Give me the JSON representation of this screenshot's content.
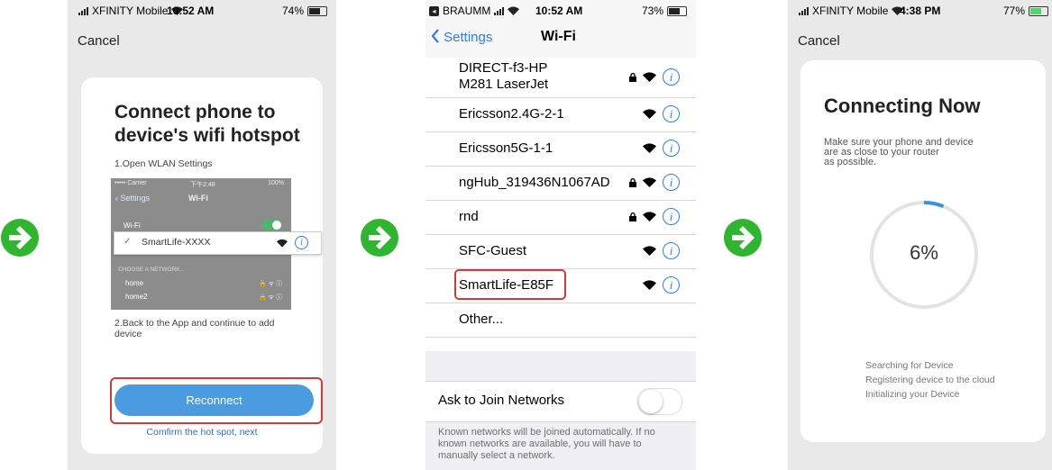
{
  "colors": {
    "accent": "#4a9be0",
    "arrow": "#2fb52f",
    "highlight": "#d03a3a",
    "ios_blue": "#2a7cf7"
  },
  "arrows": [
    "arrow-right-icon",
    "arrow-right-icon",
    "arrow-right-icon"
  ],
  "phone1": {
    "status": {
      "carrier": "XFINITY Mobile",
      "time": "10:52 AM",
      "battery": "74%",
      "battery_level": 0.74
    },
    "cancel": "Cancel",
    "title": "Connect phone to device's wifi hotspot",
    "step1": "1.Open WLAN Settings",
    "mini": {
      "carrier": "••••• Carrier",
      "time": "下午2:48",
      "battery": "100%",
      "back": "Settings",
      "title": "Wi-Fi",
      "wifi_label": "Wi-Fi",
      "selected": "SmartLife-XXXX",
      "choose": "CHOOSE A NETWORK...",
      "net1": "home",
      "net2": "home2"
    },
    "step2": "2.Back to the App and continue to add device",
    "button": "Reconnect",
    "link": "Comfirm the hot spot, next"
  },
  "phone2": {
    "status": {
      "carrier": "BRAUMM",
      "time": "10:52 AM",
      "battery": "73%",
      "battery_level": 0.73
    },
    "back": "Settings",
    "title": "Wi-Fi",
    "networks": [
      {
        "name": "DIRECT-f3-HP\nM281 LaserJet",
        "locked": true
      },
      {
        "name": "Ericsson2.4G-2-1",
        "locked": false
      },
      {
        "name": "Ericsson5G-1-1",
        "locked": false
      },
      {
        "name": "ngHub_319436N1067AD",
        "locked": true
      },
      {
        "name": "rnd",
        "locked": true
      },
      {
        "name": "SFC-Guest",
        "locked": false
      },
      {
        "name": "SmartLife-E85F",
        "locked": false
      },
      {
        "name": "Other...",
        "locked": false
      }
    ],
    "ask_label": "Ask to Join Networks",
    "ask_on": false,
    "footer": "Known networks will be joined automatically. If no known networks are available, you will have to manually select a network."
  },
  "phone3": {
    "status": {
      "carrier": "XFINITY Mobile",
      "time": "4:38 PM",
      "battery": "77%",
      "battery_level": 0.77
    },
    "cancel": "Cancel",
    "title": "Connecting Now",
    "subtitle": "Make sure your phone and device\n are as close to your router\nas possible.",
    "progress": "6%",
    "progress_value": 0.06,
    "steps": [
      "Searching for Device",
      "Registering device to the cloud",
      "Initializing your Device"
    ]
  }
}
